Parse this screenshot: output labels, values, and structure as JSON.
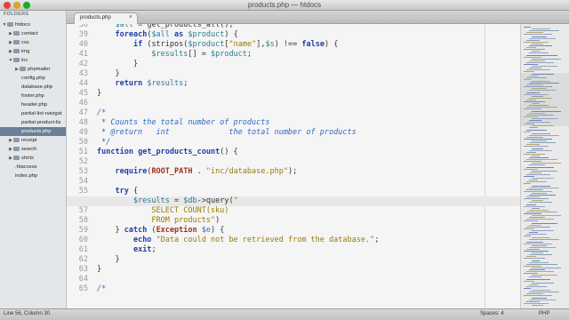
{
  "window": {
    "title": "products.php — htdocs"
  },
  "sidebar": {
    "heading": "FOLDERS",
    "items": [
      {
        "label": "htdocs",
        "type": "folder",
        "expanded": true,
        "depth": 0
      },
      {
        "label": "contact",
        "type": "folder",
        "expanded": false,
        "depth": 1
      },
      {
        "label": "css",
        "type": "folder",
        "expanded": false,
        "depth": 1
      },
      {
        "label": "img",
        "type": "folder",
        "expanded": false,
        "depth": 1
      },
      {
        "label": "inc",
        "type": "folder",
        "expanded": true,
        "depth": 1
      },
      {
        "label": "phpmailer",
        "type": "folder",
        "expanded": false,
        "depth": 2
      },
      {
        "label": "config.php",
        "type": "file",
        "depth": 2
      },
      {
        "label": "database.php",
        "type": "file",
        "depth": 2
      },
      {
        "label": "footer.php",
        "type": "file",
        "depth": 2
      },
      {
        "label": "header.php",
        "type": "file",
        "depth": 2
      },
      {
        "label": "partial-list-navigat",
        "type": "file",
        "depth": 2
      },
      {
        "label": "partial-product-lis",
        "type": "file",
        "depth": 2
      },
      {
        "label": "products.php",
        "type": "file",
        "depth": 2,
        "selected": true
      },
      {
        "label": "receipt",
        "type": "folder",
        "expanded": false,
        "depth": 1
      },
      {
        "label": "search",
        "type": "folder",
        "expanded": false,
        "depth": 1
      },
      {
        "label": "shirts",
        "type": "folder",
        "expanded": false,
        "depth": 1
      },
      {
        "label": ".htaccess",
        "type": "file",
        "depth": 1
      },
      {
        "label": "index.php",
        "type": "file",
        "depth": 1
      }
    ]
  },
  "tabs": [
    {
      "label": "products.php",
      "active": true,
      "close_glyph": "×"
    }
  ],
  "editor": {
    "current_line": 56,
    "lines": [
      {
        "num": 38,
        "tokens": [
          {
            "t": "    "
          },
          {
            "t": "$all",
            "c": "var"
          },
          {
            "t": " = get_products_all();"
          }
        ]
      },
      {
        "num": 39,
        "tokens": [
          {
            "t": "    "
          },
          {
            "t": "foreach",
            "c": "kw"
          },
          {
            "t": "("
          },
          {
            "t": "$all",
            "c": "var"
          },
          {
            "t": " "
          },
          {
            "t": "as",
            "c": "kw"
          },
          {
            "t": " "
          },
          {
            "t": "$product",
            "c": "var"
          },
          {
            "t": ") {"
          }
        ]
      },
      {
        "num": 40,
        "tokens": [
          {
            "t": "        "
          },
          {
            "t": "if",
            "c": "kw"
          },
          {
            "t": " (stripos("
          },
          {
            "t": "$product",
            "c": "var"
          },
          {
            "t": "["
          },
          {
            "t": "\"name\"",
            "c": "str"
          },
          {
            "t": "],"
          },
          {
            "t": "$s",
            "c": "var"
          },
          {
            "t": ") !== "
          },
          {
            "t": "false",
            "c": "kw"
          },
          {
            "t": ") {"
          }
        ]
      },
      {
        "num": 41,
        "tokens": [
          {
            "t": "            "
          },
          {
            "t": "$results",
            "c": "var"
          },
          {
            "t": "[] = "
          },
          {
            "t": "$product",
            "c": "var"
          },
          {
            "t": ";"
          }
        ]
      },
      {
        "num": 42,
        "tokens": [
          {
            "t": "        }"
          }
        ]
      },
      {
        "num": 43,
        "tokens": [
          {
            "t": "    }"
          }
        ]
      },
      {
        "num": 44,
        "tokens": [
          {
            "t": "    "
          },
          {
            "t": "return",
            "c": "kw"
          },
          {
            "t": " "
          },
          {
            "t": "$results",
            "c": "var"
          },
          {
            "t": ";"
          }
        ]
      },
      {
        "num": 45,
        "tokens": [
          {
            "t": "}"
          }
        ]
      },
      {
        "num": 46,
        "tokens": []
      },
      {
        "num": 47,
        "tokens": [
          {
            "t": "/*",
            "c": "cmt"
          }
        ]
      },
      {
        "num": 48,
        "tokens": [
          {
            "t": " * Counts the total number of products",
            "c": "cmt"
          }
        ]
      },
      {
        "num": 49,
        "tokens": [
          {
            "t": " * @return   int             the total number of products",
            "c": "cmt"
          }
        ]
      },
      {
        "num": 50,
        "tokens": [
          {
            "t": " */",
            "c": "cmt"
          }
        ]
      },
      {
        "num": 51,
        "tokens": [
          {
            "t": "function",
            "c": "kw"
          },
          {
            "t": " "
          },
          {
            "t": "get_products_count",
            "c": "kw"
          },
          {
            "t": "() {"
          }
        ]
      },
      {
        "num": 52,
        "tokens": []
      },
      {
        "num": 53,
        "tokens": [
          {
            "t": "    "
          },
          {
            "t": "require",
            "c": "kw"
          },
          {
            "t": "("
          },
          {
            "t": "ROOT_PATH",
            "c": "const"
          },
          {
            "t": " . "
          },
          {
            "t": "\"inc/database.php\"",
            "c": "str"
          },
          {
            "t": ");"
          }
        ]
      },
      {
        "num": 54,
        "tokens": []
      },
      {
        "num": 55,
        "tokens": [
          {
            "t": "    "
          },
          {
            "t": "try",
            "c": "kw"
          },
          {
            "t": " {"
          }
        ]
      },
      {
        "num": 56,
        "tokens": [
          {
            "t": "        "
          },
          {
            "t": "$results",
            "c": "var"
          },
          {
            "t": " = "
          },
          {
            "t": "$db",
            "c": "var"
          },
          {
            "t": "->query("
          },
          {
            "t": "\"",
            "c": "str"
          }
        ]
      },
      {
        "num": 57,
        "tokens": [
          {
            "t": "            SELECT COUNT(sku)",
            "c": "str"
          }
        ]
      },
      {
        "num": 58,
        "tokens": [
          {
            "t": "            FROM products\"",
            "c": "str"
          },
          {
            "t": ")"
          }
        ]
      },
      {
        "num": 59,
        "tokens": [
          {
            "t": "    } "
          },
          {
            "t": "catch",
            "c": "kw"
          },
          {
            "t": " ("
          },
          {
            "t": "Exception",
            "c": "const"
          },
          {
            "t": " "
          },
          {
            "t": "$e",
            "c": "var"
          },
          {
            "t": ") {"
          }
        ]
      },
      {
        "num": 60,
        "tokens": [
          {
            "t": "        "
          },
          {
            "t": "echo",
            "c": "kw"
          },
          {
            "t": " "
          },
          {
            "t": "\"Data could not be retrieved from the database.\"",
            "c": "str"
          },
          {
            "t": ";"
          }
        ]
      },
      {
        "num": 61,
        "tokens": [
          {
            "t": "        "
          },
          {
            "t": "exit",
            "c": "kw"
          },
          {
            "t": ";"
          }
        ]
      },
      {
        "num": 62,
        "tokens": [
          {
            "t": "    }"
          }
        ]
      },
      {
        "num": 63,
        "tokens": [
          {
            "t": "}"
          }
        ]
      },
      {
        "num": 64,
        "tokens": []
      },
      {
        "num": 65,
        "tokens": [
          {
            "t": "/*",
            "c": "cmt"
          }
        ]
      }
    ]
  },
  "colors": {
    "keyword": "#1f3ea8",
    "variable": "#2e7b8f",
    "string": "#9a7c00",
    "comment": "#2f6bbd",
    "constant": "#a2301e"
  },
  "statusbar": {
    "position": "Line 56, Column 30",
    "indent": "Spaces: 4",
    "syntax": "PHP"
  }
}
